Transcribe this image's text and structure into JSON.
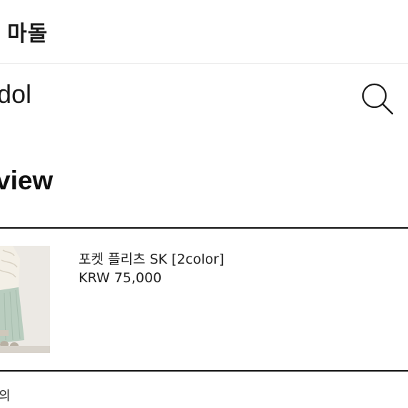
{
  "brand": {
    "title": "마돌"
  },
  "search": {
    "query": "dol",
    "icon": "search-icon"
  },
  "section": {
    "title": "view"
  },
  "product": {
    "name": "포켓 플리츠 SK [2color]",
    "price": "KRW 75,000"
  },
  "footer": {
    "text": "의"
  }
}
